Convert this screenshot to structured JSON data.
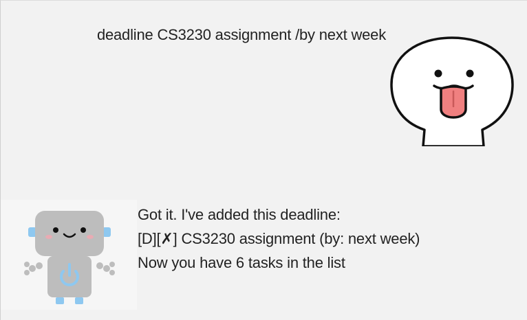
{
  "user_message": {
    "text": "deadline CS3230 assignment /by next week"
  },
  "bot_message": {
    "lines": [
      "Got it. I've added this deadline:",
      "[D][✗] CS3230 assignment (by: next week)",
      "Now you have 6 tasks in the list"
    ]
  },
  "avatars": {
    "user": "tongue-out-face-icon",
    "bot": "robot-icon"
  },
  "colors": {
    "background": "#f2f2f2",
    "text": "#222222",
    "tongue": "#f08080",
    "robot_body": "#bdbdbd",
    "robot_accent": "#8ec8f0"
  }
}
